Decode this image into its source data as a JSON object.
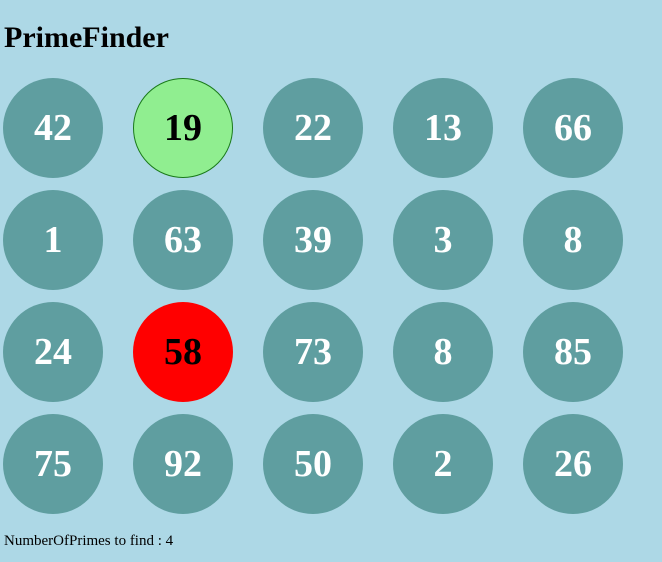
{
  "app": {
    "title": "PrimeFinder"
  },
  "grid": {
    "cells": [
      {
        "value": "42",
        "state": "default"
      },
      {
        "value": "19",
        "state": "correct"
      },
      {
        "value": "22",
        "state": "default"
      },
      {
        "value": "13",
        "state": "default"
      },
      {
        "value": "66",
        "state": "default"
      },
      {
        "value": "1",
        "state": "default"
      },
      {
        "value": "63",
        "state": "default"
      },
      {
        "value": "39",
        "state": "default"
      },
      {
        "value": "3",
        "state": "default"
      },
      {
        "value": "8",
        "state": "default"
      },
      {
        "value": "24",
        "state": "default"
      },
      {
        "value": "58",
        "state": "wrong"
      },
      {
        "value": "73",
        "state": "default"
      },
      {
        "value": "8",
        "state": "default"
      },
      {
        "value": "85",
        "state": "default"
      },
      {
        "value": "75",
        "state": "default"
      },
      {
        "value": "92",
        "state": "default"
      },
      {
        "value": "50",
        "state": "default"
      },
      {
        "value": "2",
        "state": "default"
      },
      {
        "value": "26",
        "state": "default"
      }
    ]
  },
  "footer": {
    "label": "NumberOfPrimes to find : ",
    "count": "4"
  },
  "colors": {
    "background": "#add8e6",
    "cell_default": "#5f9ea0",
    "cell_correct": "#90ee90",
    "cell_wrong": "#ff0000"
  }
}
